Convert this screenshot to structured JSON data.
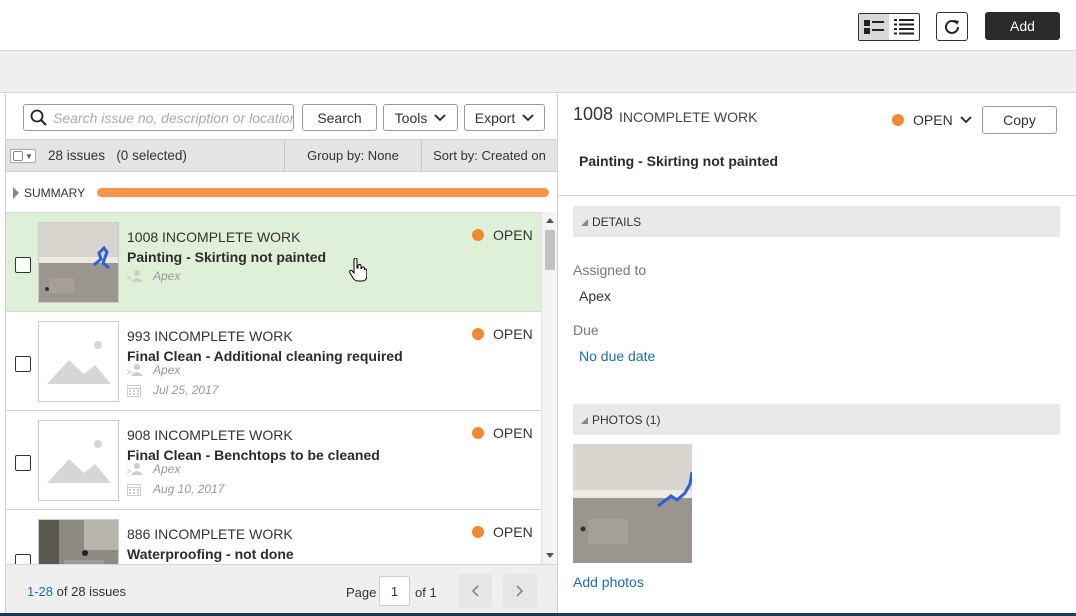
{
  "toolbar": {
    "add_label": "Add"
  },
  "search": {
    "placeholder": "Search issue no, description or location",
    "search_label": "Search",
    "tools_label": "Tools",
    "export_label": "Export"
  },
  "list_header": {
    "count_text": "28 issues",
    "selected_text": "(0 selected)",
    "group_by": "Group by: None",
    "sort_by": "Sort by: Created on"
  },
  "summary": {
    "label": "SUMMARY",
    "bar_color": "#f5964a"
  },
  "colors": {
    "status_open": "#f0892f",
    "selected_row": "#dff0d8",
    "link": "#1a6fa8"
  },
  "issues": [
    {
      "title": "1008 INCOMPLETE WORK",
      "description": "Painting - Skirting not painted",
      "assignee": "Apex",
      "due": "",
      "status": "OPEN",
      "thumbnail": "photo",
      "selected": true
    },
    {
      "title": "993 INCOMPLETE WORK",
      "description": "Final Clean - Additional cleaning required",
      "assignee": "Apex",
      "due": "Jul 25, 2017",
      "status": "OPEN",
      "thumbnail": "placeholder-image-icon",
      "selected": false
    },
    {
      "title": "908 INCOMPLETE WORK",
      "description": "Final Clean - Benchtops to be cleaned",
      "assignee": "Apex",
      "due": "Aug 10, 2017",
      "status": "OPEN",
      "thumbnail": "placeholder-image-icon",
      "selected": false
    },
    {
      "title": "886 INCOMPLETE WORK",
      "description": "Waterproofing - not done",
      "assignee": "",
      "due": "",
      "status": "OPEN",
      "thumbnail": "photo",
      "selected": false
    }
  ],
  "pagination": {
    "range": "1-28",
    "of_text": "of 28 issues",
    "page_label": "Page",
    "page_value": "1",
    "page_total": "of 1"
  },
  "detail": {
    "number": "1008",
    "type": "INCOMPLETE WORK",
    "status": "OPEN",
    "copy_label": "Copy",
    "description": "Painting - Skirting not painted",
    "details_section": "DETAILS",
    "assigned_label": "Assigned to",
    "assigned_value": "Apex",
    "due_label": "Due",
    "due_value": "No due date",
    "photos_section": "PHOTOS (1)",
    "add_photos": "Add photos"
  }
}
